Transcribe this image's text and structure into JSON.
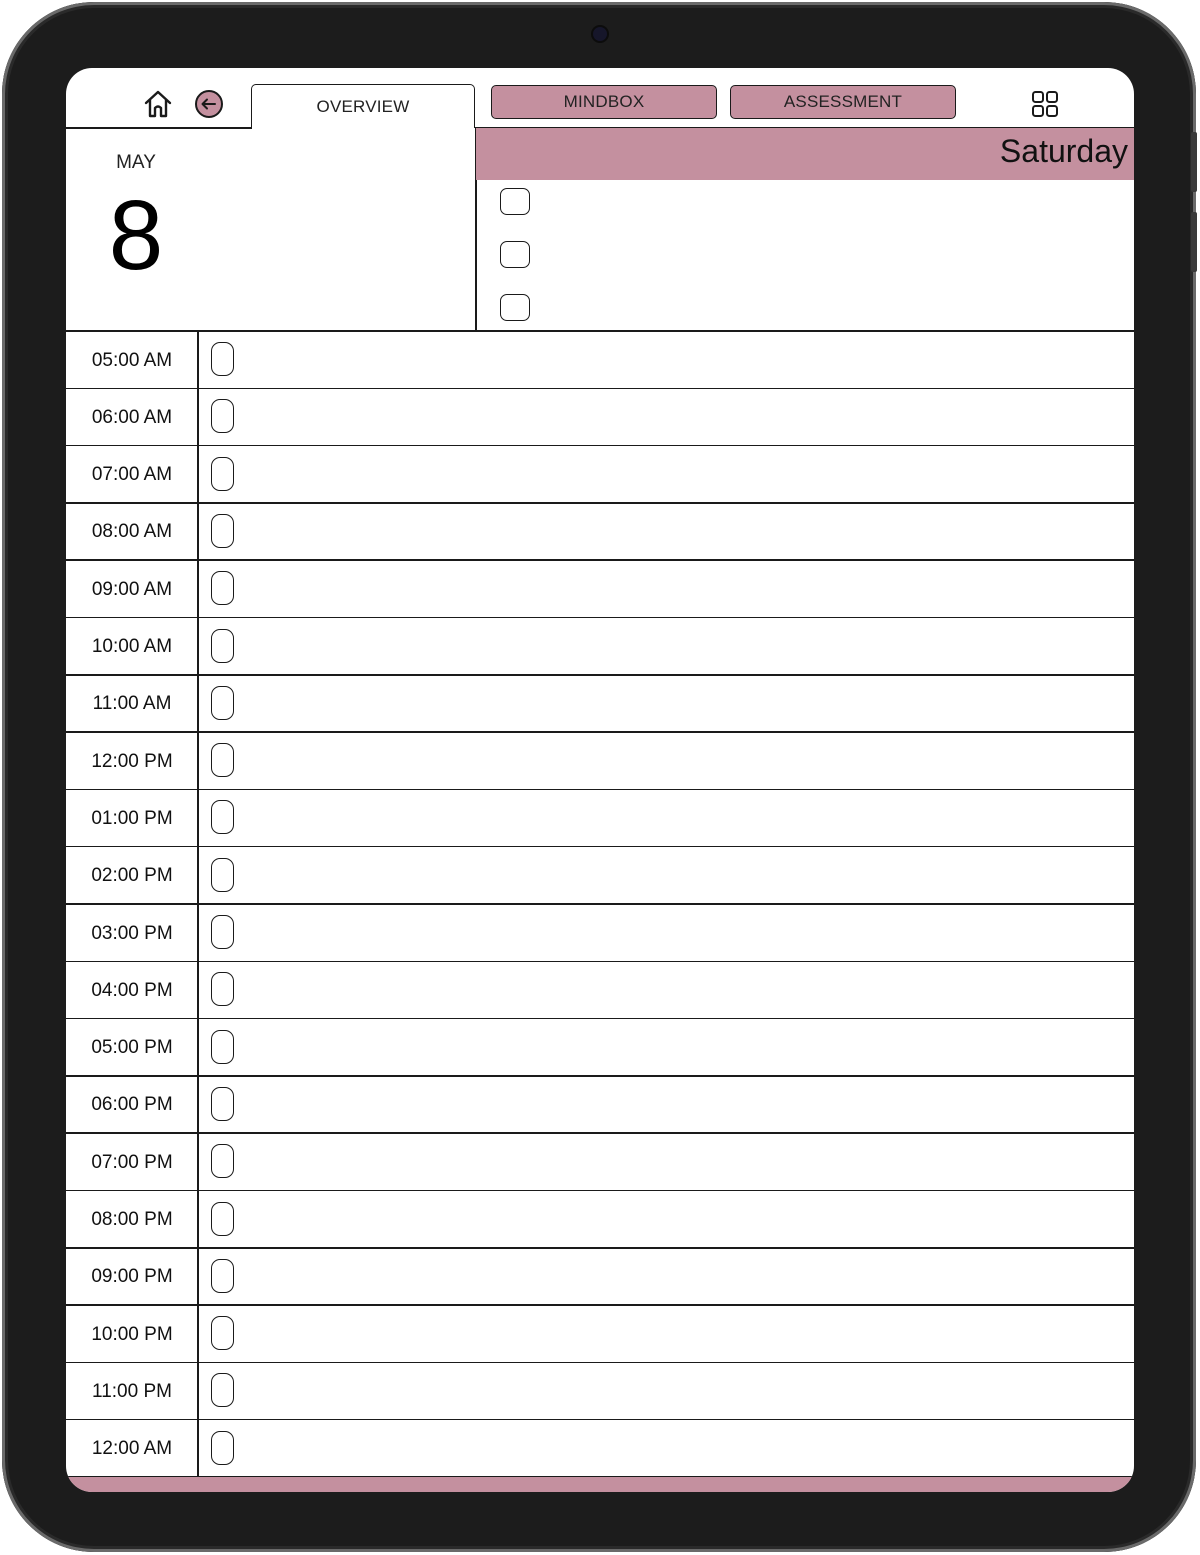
{
  "colors": {
    "accent": "#c4909f",
    "line": "#1a1a1a"
  },
  "nav": {
    "home_icon": "home-icon",
    "back_icon": "back-arrow-icon",
    "grid_icon": "grid-menu-icon",
    "tabs": [
      {
        "label": "OVERVIEW",
        "active": true
      },
      {
        "label": "MINDBOX",
        "active": false
      },
      {
        "label": "ASSESSMENT",
        "active": false
      }
    ]
  },
  "date": {
    "month": "MAY",
    "day": "8",
    "weekday": "Saturday"
  },
  "priorities": {
    "count": 3
  },
  "schedule": {
    "times": [
      "05:00 AM",
      "06:00 AM",
      "07:00 AM",
      "08:00 AM",
      "09:00 AM",
      "10:00 AM",
      "11:00 AM",
      "12:00 PM",
      "01:00 PM",
      "02:00 PM",
      "03:00 PM",
      "04:00 PM",
      "05:00 PM",
      "06:00 PM",
      "07:00 PM",
      "08:00 PM",
      "09:00 PM",
      "10:00 PM",
      "11:00 PM",
      "12:00 AM"
    ]
  }
}
